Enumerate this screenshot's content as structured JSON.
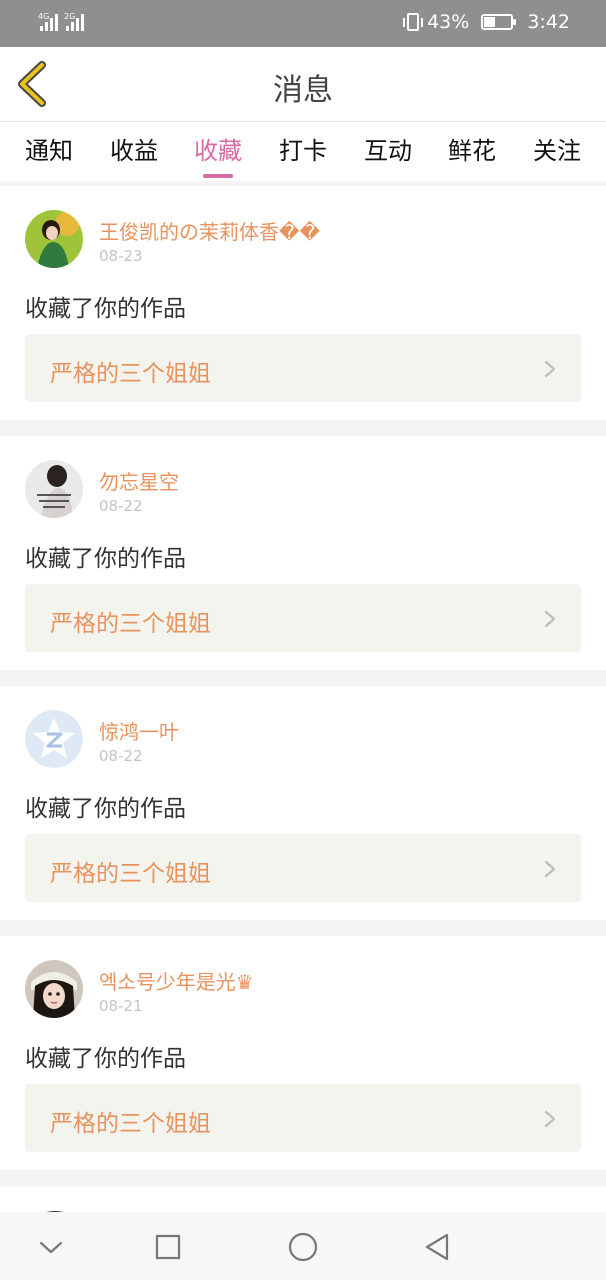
{
  "status_bar": {
    "signal1_label": "4G",
    "signal2_label": "2G",
    "battery_percent": "43%",
    "time": "3:42"
  },
  "header": {
    "title": "消息"
  },
  "tabs": [
    {
      "label": "通知"
    },
    {
      "label": "收益"
    },
    {
      "label": "收藏",
      "active": true
    },
    {
      "label": "打卡"
    },
    {
      "label": "互动"
    },
    {
      "label": "鲜花"
    },
    {
      "label": "关注"
    }
  ],
  "messages": [
    {
      "user": "王俊凯的の茉莉体香��",
      "date": "08-23",
      "action": "收藏了你的作品",
      "work_title": "严格的三个姐姐"
    },
    {
      "user": "勿忘星空",
      "date": "08-22",
      "action": "收藏了你的作品",
      "work_title": "严格的三个姐姐"
    },
    {
      "user": "惊鸿一叶",
      "date": "08-22",
      "action": "收藏了你的作品",
      "work_title": "严格的三个姐姐"
    },
    {
      "user": "엑소号少年是光♛",
      "date": "08-21",
      "action": "收藏了你的作品",
      "work_title": "严格的三个姐姐"
    }
  ],
  "colors": {
    "accent_pink": "#d86aa6",
    "name_orange": "#e8935e",
    "back_yellow": "#e7c31f"
  },
  "icons": {
    "back": "chevron-left-icon",
    "work_arrow": "chevron-right-icon",
    "nav_hide": "chevron-down-icon",
    "nav_recent": "square-icon",
    "nav_home": "circle-icon",
    "nav_back": "triangle-back-icon"
  }
}
